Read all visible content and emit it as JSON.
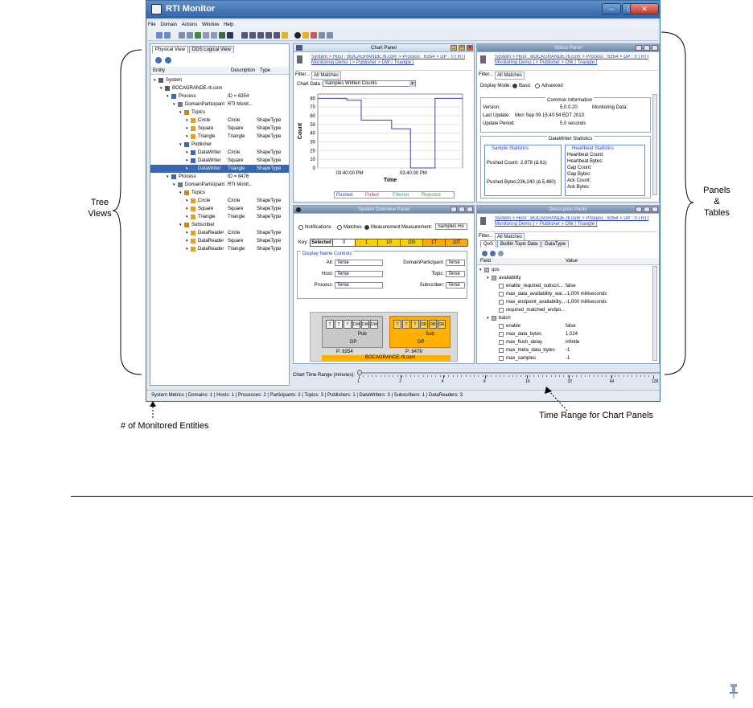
{
  "window": {
    "title": "RTI Monitor",
    "minimize": "–",
    "maximize": "□",
    "close": "✕",
    "menu": [
      "File",
      "Domain",
      "Actions",
      "Window",
      "Help"
    ]
  },
  "tree_panel": {
    "tabs": [
      "Physical View",
      "DDS Logical View"
    ],
    "columns": [
      "Entity",
      "Description",
      "Type"
    ],
    "rows": [
      {
        "indent": 0,
        "name": "System",
        "desc": "",
        "type": "",
        "icon": "#557"
      },
      {
        "indent": 1,
        "name": "BOCAGRANDE.rti.com",
        "desc": "",
        "type": "",
        "icon": "#556"
      },
      {
        "indent": 2,
        "name": "Process",
        "desc": "ID = 6354",
        "type": "",
        "icon": "#3a6ab8"
      },
      {
        "indent": 3,
        "name": "DomainParticipant",
        "desc": "RTI Monit...",
        "type": "",
        "icon": "#6a7a98"
      },
      {
        "indent": 4,
        "name": "Topics",
        "desc": "",
        "type": "",
        "icon": "#c98a1a"
      },
      {
        "indent": 5,
        "name": "Circle",
        "desc": "Circle",
        "type": "ShapeType",
        "icon": "#e6a020"
      },
      {
        "indent": 5,
        "name": "Square",
        "desc": "Square",
        "type": "ShapeType",
        "icon": "#e6a020"
      },
      {
        "indent": 5,
        "name": "Triangle",
        "desc": "Triangle",
        "type": "ShapeType",
        "icon": "#e6a020"
      },
      {
        "indent": 4,
        "name": "Publisher",
        "desc": "",
        "type": "",
        "icon": "#3a6ab8"
      },
      {
        "indent": 5,
        "name": "DataWriter",
        "desc": "Circle",
        "type": "ShapeType",
        "icon": "#3a6ab8"
      },
      {
        "indent": 5,
        "name": "DataWriter",
        "desc": "Square",
        "type": "ShapeType",
        "icon": "#3a6ab8"
      },
      {
        "indent": 5,
        "name": "DataWriter",
        "desc": "Triangle",
        "type": "ShapeType",
        "icon": "#3a6ab8",
        "selected": true
      },
      {
        "indent": 2,
        "name": "Process",
        "desc": "ID = 8476",
        "type": "",
        "icon": "#3a6ab8"
      },
      {
        "indent": 3,
        "name": "DomainParticipant",
        "desc": "RTI Monit...",
        "type": "",
        "icon": "#6a7a98"
      },
      {
        "indent": 4,
        "name": "Topics",
        "desc": "",
        "type": "",
        "icon": "#c98a1a"
      },
      {
        "indent": 5,
        "name": "Circle",
        "desc": "Circle",
        "type": "ShapeType",
        "icon": "#e6a020"
      },
      {
        "indent": 5,
        "name": "Square",
        "desc": "Square",
        "type": "ShapeType",
        "icon": "#e6a020"
      },
      {
        "indent": 5,
        "name": "Triangle",
        "desc": "Triangle",
        "type": "ShapeType",
        "icon": "#e6a020"
      },
      {
        "indent": 4,
        "name": "Subscriber",
        "desc": "",
        "type": "",
        "icon": "#c98a1a"
      },
      {
        "indent": 5,
        "name": "DataReader",
        "desc": "Circle",
        "type": "ShapeType",
        "icon": "#e6a020"
      },
      {
        "indent": 5,
        "name": "DataReader",
        "desc": "Square",
        "type": "ShapeType",
        "icon": "#e6a020"
      },
      {
        "indent": 5,
        "name": "DataReader",
        "desc": "Triangle",
        "type": "ShapeType",
        "icon": "#e6a020"
      }
    ]
  },
  "chart_panel": {
    "title": "Chart Panel",
    "breadcrumb": "System > Host : BOCAGRANDE.rti.com > Process : 6354 > DP : 0 [ RTI Monitoring Demo ] > Publisher > DW [ Triangle ]",
    "filter_label": "Filter...",
    "filter_tab": "All Matches",
    "chart_data_label": "Chart Data :",
    "chart_data_value": "Samples Written Counts",
    "legend": [
      "Pushed",
      "Pulled",
      "Filtered",
      "Rejected"
    ]
  },
  "chart_data": {
    "type": "line",
    "xlabel": "Time",
    "ylabel": "Count",
    "ylim": [
      0,
      85
    ],
    "yticks": [
      0,
      10,
      20,
      30,
      40,
      50,
      60,
      70,
      80
    ],
    "xticks": [
      "03:40:00 PM",
      "03:40:30 PM"
    ],
    "series": [
      {
        "name": "Pushed",
        "color": "#4040b0",
        "points": [
          [
            0,
            80
          ],
          [
            0.2,
            80
          ],
          [
            0.2,
            78
          ],
          [
            0.3,
            78
          ],
          [
            0.3,
            55
          ],
          [
            0.51,
            55
          ],
          [
            0.51,
            45
          ],
          [
            0.64,
            45
          ],
          [
            0.64,
            0
          ],
          [
            0.81,
            0
          ],
          [
            0.81,
            80
          ],
          [
            1,
            80
          ]
        ]
      }
    ]
  },
  "status_panel": {
    "title": "Status Panel",
    "breadcrumb": "System > Host : BOCAGRANDE.rti.com > Process : 6354 > DP : 0 [ RTI Monitoring Demo ] > Publisher > DW [ Triangle ]",
    "filter_label": "Filter...",
    "filter_tab": "All Matches",
    "display_mode_label": "Display Mode:",
    "modes": [
      "Basic",
      "Advanced"
    ],
    "common_info_title": "Common Information",
    "version_label": "Version:",
    "version_value": "5.0.0.20",
    "monitoring_label": "Monitoring Data:",
    "last_update_label": "Last Update:",
    "last_update_value": "Mon Sep 09 15:40:54 EDT 2013",
    "update_period_label": "Update Period:",
    "update_period_value": "5.0 seconds",
    "dw_stats_title": "DataWriter Statistics",
    "sample_stats_title": "Sample Statistics",
    "heartbeat_title": "Heartbeat Statistics",
    "pushed_count_label": "Pushed Count:",
    "pushed_count_value": "2,978  (Δ 61)",
    "pushed_bytes_label": "Pushed Bytes:",
    "pushed_bytes_value": "236,240  (Δ 5,480)",
    "heartbeat_items": [
      "Heartbeat Count:",
      "Heartbeat Bytes:",
      "Gap Count:",
      "Gap Bytes:",
      "Ack Count:",
      "Ack Bytes:"
    ]
  },
  "overview_panel": {
    "title": "System Overview Panel",
    "radios": [
      "Notifications",
      "Matches",
      "Measurement"
    ],
    "measurement_label": "Measurement:",
    "measurement_value": "Samples Re",
    "key_label": "Key:",
    "key_items": [
      {
        "label": "Selected",
        "color": "#ffffff"
      },
      {
        "label": "0",
        "color": "#ffffff"
      },
      {
        "label": "1",
        "color": "#ffd000"
      },
      {
        "label": "10",
        "color": "#ffd000"
      },
      {
        "label": "100",
        "color": "#ffd000"
      },
      {
        "label": "1T",
        "color": "#ffaa00"
      },
      {
        "label": "10T",
        "color": "#ffaa00"
      }
    ],
    "controls_title": "Display Name Controls",
    "left_controls": [
      {
        "label": "All:",
        "value": "Terse"
      },
      {
        "label": "Host:",
        "value": "Terse"
      },
      {
        "label": "Process:",
        "value": "Terse"
      }
    ],
    "right_controls": [
      {
        "label": "DomainParticipant:",
        "value": "Terse"
      },
      {
        "label": "Topic:",
        "value": "Terse"
      },
      {
        "label": "Subscriber:",
        "value": "Terse"
      }
    ],
    "pub_boxes": [
      "T",
      "T",
      "T",
      "DW",
      "DW",
      "DW"
    ],
    "pub_label": "Pub",
    "pub_dp": "DP",
    "pub_process": "P: 6354",
    "sub_boxes": [
      "T",
      "T",
      "T",
      "DR",
      "DR",
      "DR"
    ],
    "sub_label": "Sub",
    "sub_dp": "DP",
    "sub_process": "P: 8476",
    "host_label": "BOCAGRANDE.rti.com"
  },
  "description_panel": {
    "title": "Description Panel",
    "breadcrumb": "System > Host : BOCAGRANDE.rti.com > Process : 6354 > DP : 0 [ RTI Monitoring Demo ] > Publisher > DW [ Triangle ]",
    "filter_label": "Filter...",
    "filter_tab": "All Matches",
    "tabs": [
      "QoS",
      "Builtin Topic Data",
      "DataType"
    ],
    "columns": [
      "Field",
      "Value"
    ],
    "rows": [
      {
        "indent": 0,
        "field": "qos",
        "value": "",
        "folder": true
      },
      {
        "indent": 1,
        "field": "availability",
        "value": "",
        "folder": true
      },
      {
        "indent": 2,
        "field": "enable_required_subscri...",
        "value": "false"
      },
      {
        "indent": 2,
        "field": "max_data_availability_wai...",
        "value": "-1,000 milliseconds"
      },
      {
        "indent": 2,
        "field": "max_endpoint_availability...",
        "value": "-1,000 milliseconds"
      },
      {
        "indent": 2,
        "field": "required_matched_endpo...",
        "value": ""
      },
      {
        "indent": 1,
        "field": "batch",
        "value": "",
        "folder": true
      },
      {
        "indent": 2,
        "field": "enable",
        "value": "false"
      },
      {
        "indent": 2,
        "field": "max_data_bytes",
        "value": "1,024"
      },
      {
        "indent": 2,
        "field": "max_flush_delay",
        "value": "infinite"
      },
      {
        "indent": 2,
        "field": "max_meta_data_bytes",
        "value": "-1"
      },
      {
        "indent": 2,
        "field": "max_samples",
        "value": "-1"
      }
    ]
  },
  "time_range": {
    "label": "Chart Time Range (minutes):",
    "ticks": [
      "1",
      "2",
      "4",
      "8",
      "16",
      "32",
      "64",
      "128"
    ]
  },
  "status_bar": "System Metrics | Domains: 1 | Hosts: 1 | Processes: 2 | Participants: 2 | Topics: 3 | Publishers: 1 | DataWriters: 3 | Subscribers: 1 | DataReaders: 3",
  "annotations": {
    "tree_views": "Tree\nViews",
    "panels_tables": "Panels\n&\nTables",
    "monitored_entities": "# of Monitored Entities",
    "time_range": "Time Range for Chart Panels"
  }
}
